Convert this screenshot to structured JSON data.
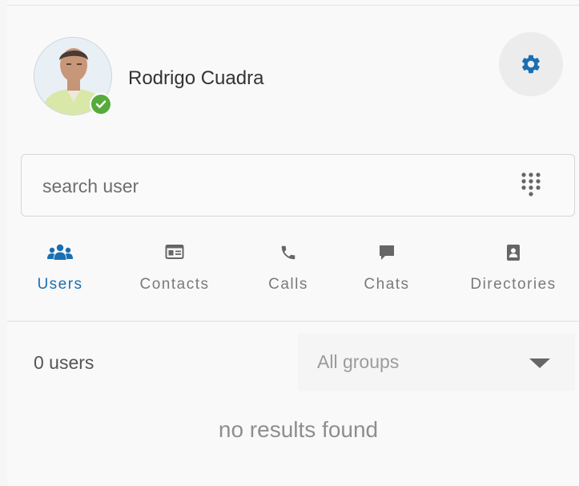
{
  "user": {
    "name": "Rodrigo Cuadra",
    "status": "online"
  },
  "search": {
    "placeholder": "search user",
    "value": ""
  },
  "tabs": [
    {
      "label": "Users",
      "icon": "users-icon",
      "active": true
    },
    {
      "label": "Contacts",
      "icon": "contact-card-icon",
      "active": false
    },
    {
      "label": "Calls",
      "icon": "phone-icon",
      "active": false
    },
    {
      "label": "Chats",
      "icon": "chat-bubble-icon",
      "active": false
    },
    {
      "label": "Directories",
      "icon": "address-book-icon",
      "active": false
    }
  ],
  "list": {
    "count_label": "0 users",
    "group_filter": "All groups",
    "empty_message": "no results found"
  },
  "colors": {
    "accent": "#1a6fb3",
    "status_online": "#56ab3b",
    "icon_gray": "#666666"
  }
}
